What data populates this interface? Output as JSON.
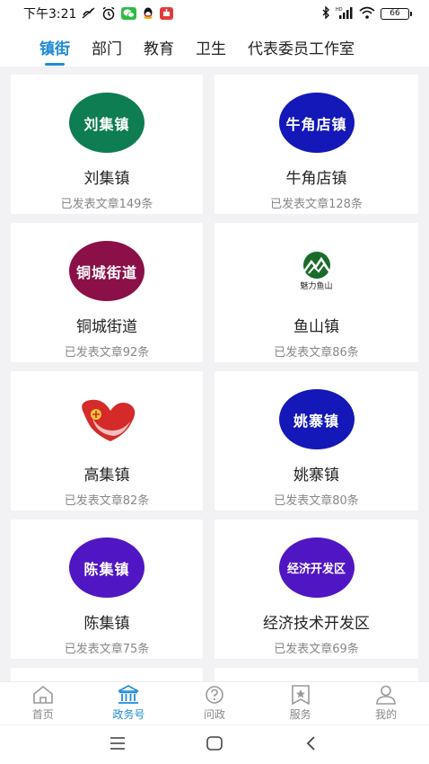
{
  "status_bar": {
    "time": "下午3:21",
    "battery": "66"
  },
  "tabs": [
    {
      "label": "镇街",
      "active": true
    },
    {
      "label": "部门",
      "active": false
    },
    {
      "label": "教育",
      "active": false
    },
    {
      "label": "卫生",
      "active": false
    },
    {
      "label": "代表委员工作室",
      "active": false
    }
  ],
  "cards": [
    {
      "logo_text": "刘集镇",
      "logo_color": "#0e7d52",
      "name": "刘集镇",
      "count": "已发表文章149条"
    },
    {
      "logo_text": "牛角店镇",
      "logo_color": "#1418b8",
      "name": "牛角店镇",
      "count": "已发表文章128条"
    },
    {
      "logo_text": "铜城街道",
      "logo_color": "#8b1048",
      "name": "铜城街道",
      "count": "已发表文章92条"
    },
    {
      "logo_text": "魅力鱼山",
      "logo_color": "#1a6b2a",
      "name": "鱼山镇",
      "count": "已发表文章86条"
    },
    {
      "logo_text": "",
      "logo_color": "#d42a2a",
      "name": "高集镇",
      "count": "已发表文章82条"
    },
    {
      "logo_text": "姚寨镇",
      "logo_color": "#1418b8",
      "name": "姚寨镇",
      "count": "已发表文章80条"
    },
    {
      "logo_text": "陈集镇",
      "logo_color": "#5116c4",
      "name": "陈集镇",
      "count": "已发表文章75条"
    },
    {
      "logo_text": "经济开发区",
      "logo_color": "#5116c4",
      "name": "经济技术开发区",
      "count": "已发表文章69条"
    }
  ],
  "bottom_nav": [
    {
      "label": "首页",
      "icon": "home-icon",
      "active": false
    },
    {
      "label": "政务号",
      "icon": "government-icon",
      "active": true
    },
    {
      "label": "问政",
      "icon": "question-icon",
      "active": false
    },
    {
      "label": "服务",
      "icon": "service-icon",
      "active": false
    },
    {
      "label": "我的",
      "icon": "profile-icon",
      "active": false
    }
  ],
  "colors": {
    "accent": "#1f8bd6",
    "background": "#f2f2f4",
    "muted_text": "#888888"
  }
}
